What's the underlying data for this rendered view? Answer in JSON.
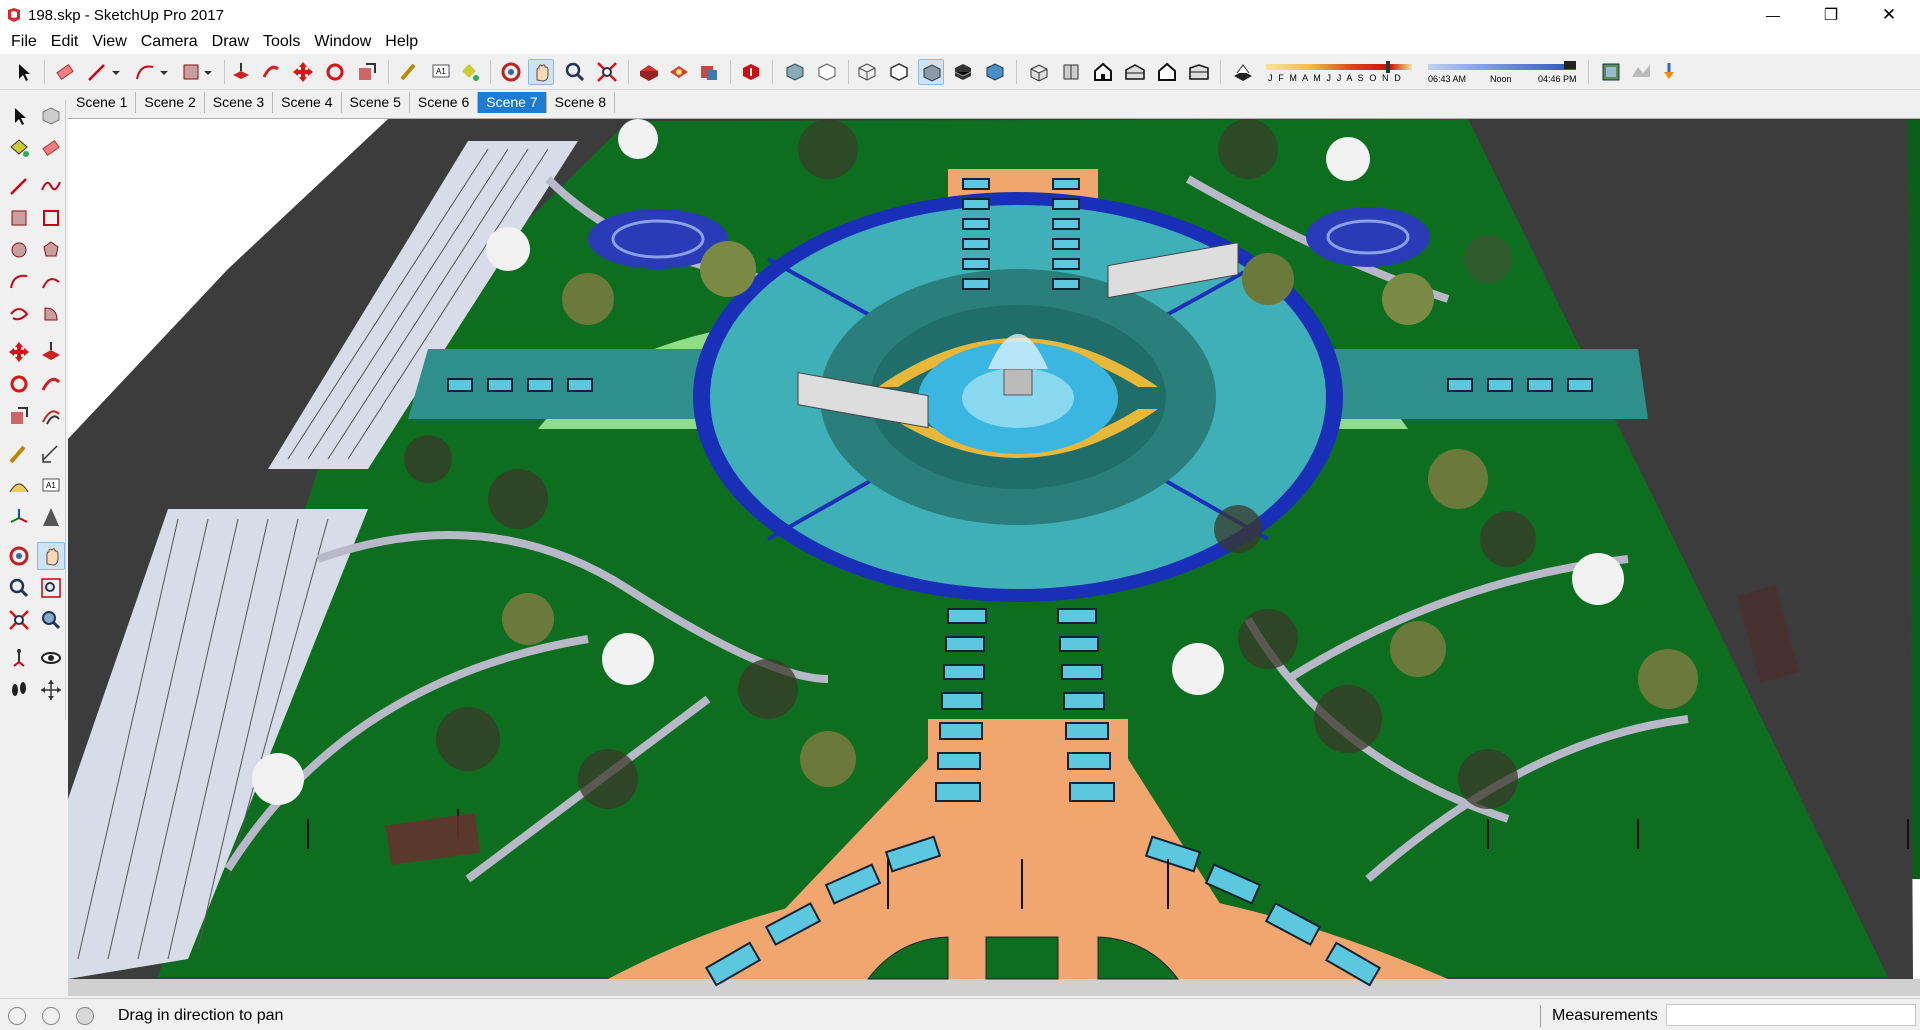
{
  "window": {
    "title": "198.skp - SketchUp Pro 2017",
    "minimize_glyph": "—",
    "restore_glyph": "❐",
    "close_glyph": "✕"
  },
  "menu": [
    "File",
    "Edit",
    "View",
    "Camera",
    "Draw",
    "Tools",
    "Window",
    "Help"
  ],
  "toolbar": {
    "shadow_months": "J F M A M J J A S O N D",
    "shadow_time_start": "06:43 AM",
    "shadow_time_mid": "Noon",
    "shadow_time_end": "04:46 PM",
    "active_tool": "pan-icon"
  },
  "scenes": {
    "tabs": [
      "Scene 1",
      "Scene 2",
      "Scene 3",
      "Scene 4",
      "Scene 5",
      "Scene 6",
      "Scene 7",
      "Scene 8"
    ],
    "selected": "Scene 7"
  },
  "palette": {
    "icons": [
      "select-icon",
      "component-icon",
      "paint-bucket-icon",
      "eraser-icon",
      "line-icon",
      "freehand-icon",
      "rectangle-icon",
      "rotated-rectangle-icon",
      "circle-icon",
      "polygon-icon",
      "arc-icon",
      "pie-icon",
      "two-point-arc-icon",
      "three-point-arc-icon",
      "move-icon",
      "push-pull-icon",
      "rotate-icon",
      "follow-me-icon",
      "scale-icon",
      "offset-icon",
      "tape-measure-icon",
      "dimension-icon",
      "protractor-icon",
      "text-icon",
      "axes-icon",
      "3d-text-icon",
      "orbit-icon",
      "pan-icon",
      "zoom-icon",
      "zoom-window-icon",
      "zoom-extents-icon",
      "previous-view-icon",
      "position-camera-icon",
      "look-around-icon",
      "walk-icon",
      "section-plane-icon"
    ]
  },
  "status": {
    "message": "Drag in direction to pan",
    "measurements_label": "Measurements",
    "measurements_value": ""
  },
  "colors": {
    "grass": "#0d6e1f",
    "road": "#3c3c3c",
    "path_orange": "#f0a66e",
    "plaza_teal": "#2a7f7c",
    "fountain_blue": "#3bb6e0",
    "ring_blue": "#1a2fb8",
    "bench_yellow": "#e8b83a",
    "tab_selected": "#1e7bd2"
  }
}
